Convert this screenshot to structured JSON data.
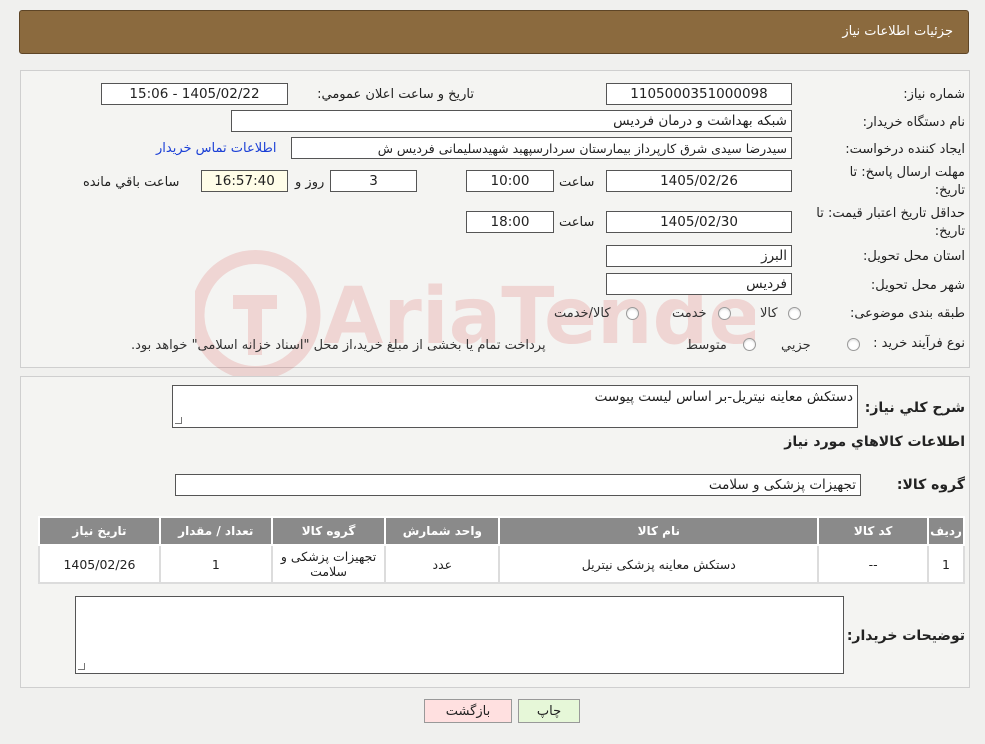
{
  "header": {
    "title": "جزئیات اطلاعات نیاز"
  },
  "form": {
    "need_number_label": "شماره نیاز:",
    "need_number": "1105000351000098",
    "announce_label": "تاریخ و ساعت اعلان عمومي:",
    "announce_value": "1405/02/22 - 15:06",
    "buyer_org_label": "نام دستگاه خريدار:",
    "buyer_org": "شبکه بهداشت و درمان فردیس",
    "creator_label": "ايجاد کننده درخواست:",
    "creator": "سیدرضا سیدی شرق کارپرداز بیمارستان سردارسپهبد شهیدسلیمانی فردیس ش",
    "contact_link": "اطلاعات تماس خريدار",
    "deadline_label_1": "مهلت ارسال پاسخ: تا",
    "deadline_label_2": "تاريخ:",
    "deadline_date": "1405/02/26",
    "time_label": "ساعت",
    "deadline_time": "10:00",
    "days": "3",
    "days_label": "روز و",
    "remaining": "16:57:40",
    "remaining_label": "ساعت باقي مانده",
    "validity_label_1": "حداقل تاريخ اعتبار قيمت: تا",
    "validity_label_2": "تاريخ:",
    "validity_date": "1405/02/30",
    "validity_time": "18:00",
    "province_label": "استان محل تحويل:",
    "province": "البرز",
    "city_label": "شهر محل تحويل:",
    "city": "فرديس",
    "category_label": "طبقه بندی موضوعی:",
    "category_options": [
      "کالا",
      "خدمت",
      "کالا/خدمت"
    ],
    "process_label": "نوع فرآيند خريد :",
    "process_options": [
      "جزيي",
      "متوسط"
    ],
    "process_note": "پرداخت تمام يا بخشی از مبلغ خريد،از محل \"اسناد خزانه اسلامی\" خواهد بود."
  },
  "description": {
    "label": "شرح كلي نياز:",
    "value": "دستکش معاینه نیتریل-بر اساس لیست پیوست"
  },
  "goods": {
    "section_title": "اطلاعات كالاهاي مورد نياز",
    "group_label": "گروه كالا:",
    "group_value": "تجهیزات پزشکی و سلامت",
    "columns": [
      "رديف",
      "کد کالا",
      "نام کالا",
      "واحد شمارش",
      "گروه کالا",
      "تعداد / مقدار",
      "تاريخ نياز"
    ],
    "rows": [
      [
        "1",
        "--",
        "دستکش معاینه پزشکی نیتریل",
        "عدد",
        "تجهیزات پزشکی و سلامت",
        "1",
        "1405/02/26"
      ]
    ]
  },
  "buyer_notes": {
    "label": "توضيحات خريدار:",
    "value": ""
  },
  "buttons": {
    "print": "چاپ",
    "back": "بازگشت"
  },
  "watermark": {
    "text": "AriaTender.neT"
  },
  "colors": {
    "header_bg": "#8b6a3e",
    "link": "#1a3fd6",
    "back_bg": "#ffe0e0",
    "print_bg": "#e6f7d8"
  }
}
